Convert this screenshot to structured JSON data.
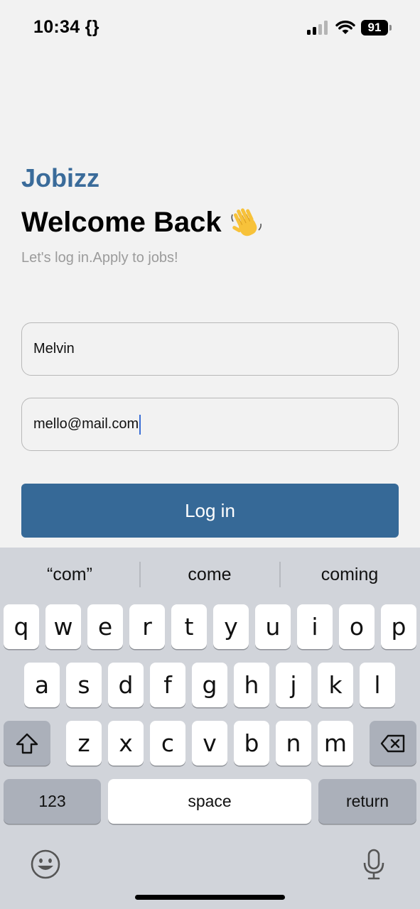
{
  "status_bar": {
    "time": "10:34 {}",
    "battery": "91"
  },
  "header": {
    "brand": "Jobizz",
    "title": "Welcome Back",
    "subtitle": "Let's log in.Apply to jobs!"
  },
  "form": {
    "name_value": "Melvin",
    "email_value": "mello@mail.com",
    "login_label": "Log in"
  },
  "keyboard": {
    "suggestions": [
      "“com”",
      "come",
      "coming"
    ],
    "row1": [
      "q",
      "w",
      "e",
      "r",
      "t",
      "y",
      "u",
      "i",
      "o",
      "p"
    ],
    "row2": [
      "a",
      "s",
      "d",
      "f",
      "g",
      "h",
      "j",
      "k",
      "l"
    ],
    "row3": [
      "z",
      "x",
      "c",
      "v",
      "b",
      "n",
      "m"
    ],
    "numbers_label": "123",
    "space_label": "space",
    "return_label": "return"
  },
  "colors": {
    "brand": "#3a6b9a",
    "button": "#366997",
    "caret": "#3b6fd6"
  }
}
